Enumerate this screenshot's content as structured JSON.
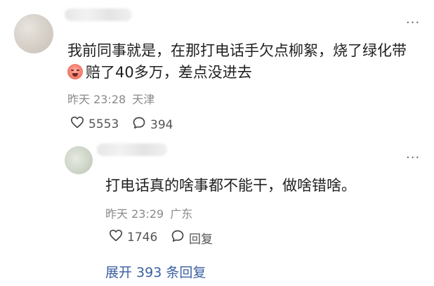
{
  "comment": {
    "text_line1": "我前同事就是，在那打电话手欠点柳絮，烧了绿化带",
    "text_line2": "赔了40多万，差点没进去",
    "time": "昨天 23:28",
    "location": "天津",
    "likes": "5553",
    "replies_count": "394",
    "more_icon": "···"
  },
  "reply": {
    "text": "打电话真的啥事都不能干，做啥错啥。",
    "time": "昨天 23:29",
    "location": "广东",
    "likes": "1746",
    "reply_label": "回复",
    "more_icon": "···"
  },
  "expand": {
    "label": "展开 393 条回复"
  }
}
